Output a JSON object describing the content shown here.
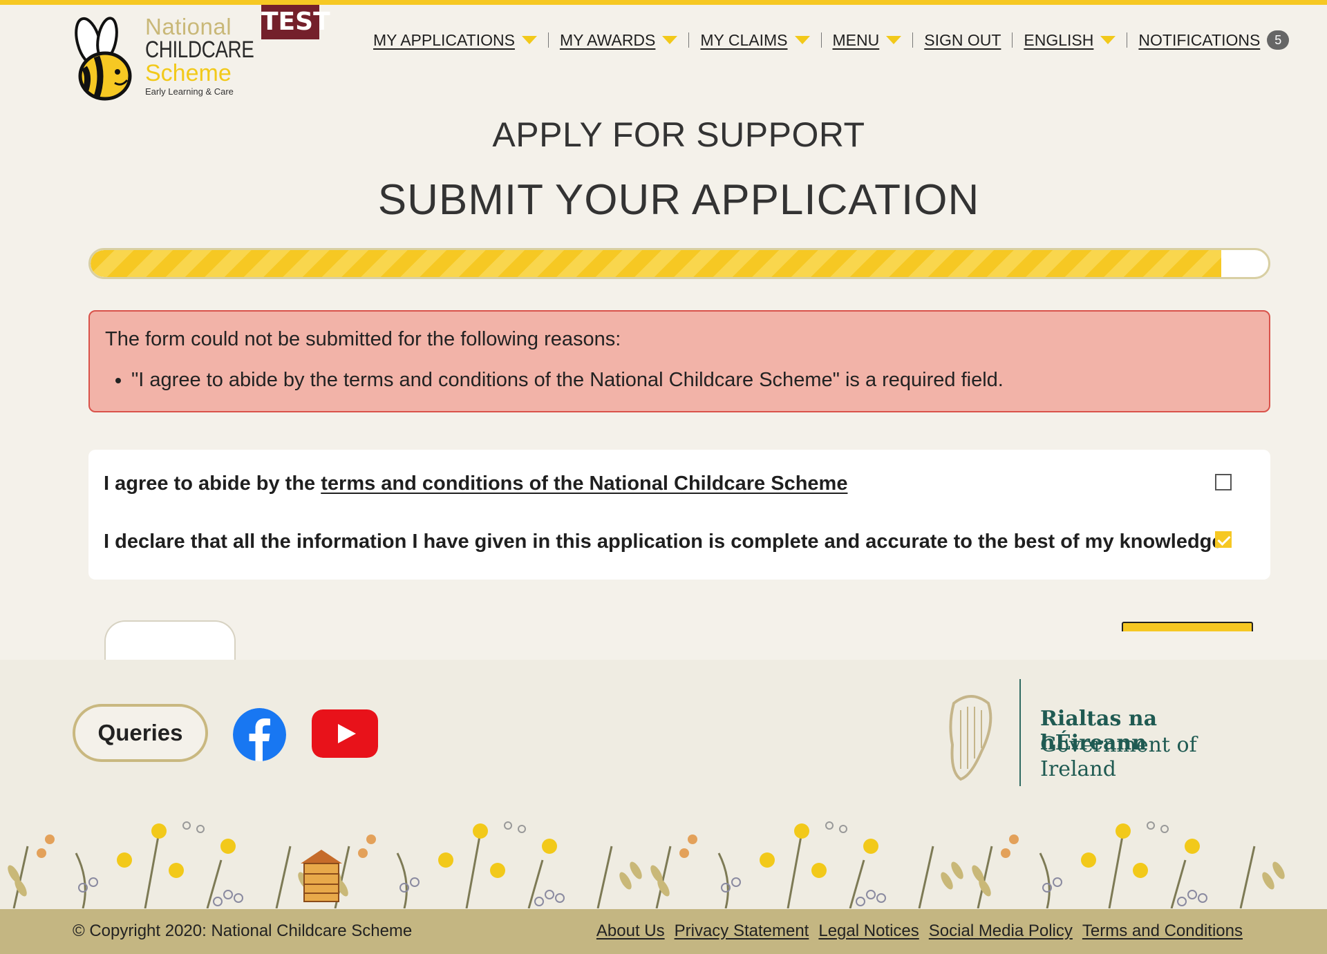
{
  "header": {
    "logo": {
      "line1": "National",
      "line2": "CHILDCARE",
      "line3": "Scheme",
      "line4": "Early Learning & Care"
    },
    "env_badge": "TEST",
    "nav": [
      {
        "label": "MY APPLICATIONS",
        "has_dropdown": true
      },
      {
        "label": "MY AWARDS",
        "has_dropdown": true
      },
      {
        "label": "MY CLAIMS",
        "has_dropdown": true
      },
      {
        "label": "MENU",
        "has_dropdown": true
      },
      {
        "label": "SIGN OUT",
        "has_dropdown": false
      },
      {
        "label": "ENGLISH",
        "has_dropdown": true
      },
      {
        "label": "NOTIFICATIONS",
        "has_dropdown": false
      }
    ],
    "notification_count": "5"
  },
  "page": {
    "subtitle": "APPLY FOR SUPPORT",
    "title": "SUBMIT YOUR APPLICATION",
    "progress_fraction": 0.96
  },
  "error": {
    "heading": "The form could not be submitted for the following reasons:",
    "items": [
      "\"I agree to abide by the terms and conditions of the National Childcare Scheme\" is a required field."
    ]
  },
  "declarations": {
    "terms_prefix": "I agree to abide by the ",
    "terms_link": "terms and conditions of the National Childcare Scheme",
    "terms_checked": false,
    "accuracy_label": "I declare that all the information I have given in this application is complete and accurate to the best of my knowledge",
    "accuracy_checked": true
  },
  "footer": {
    "queries_label": "Queries",
    "gov_line1": "Rialtas na hÉireann",
    "gov_line2": "Government of Ireland",
    "copyright": "© Copyright 2020: National Childcare Scheme",
    "links": [
      "About Us",
      "Privacy Statement",
      "Legal Notices",
      "Social Media Policy",
      "Terms and Conditions"
    ]
  },
  "colors": {
    "brand_yellow": "#f6c823",
    "error_bg": "#f2b3a8",
    "footer_bar": "#c4b682",
    "gov_green": "#1f5a52"
  },
  "icons": [
    "bee-logo-icon",
    "facebook-icon",
    "youtube-icon",
    "harp-icon",
    "caret-down-icon",
    "beehive-icon"
  ]
}
